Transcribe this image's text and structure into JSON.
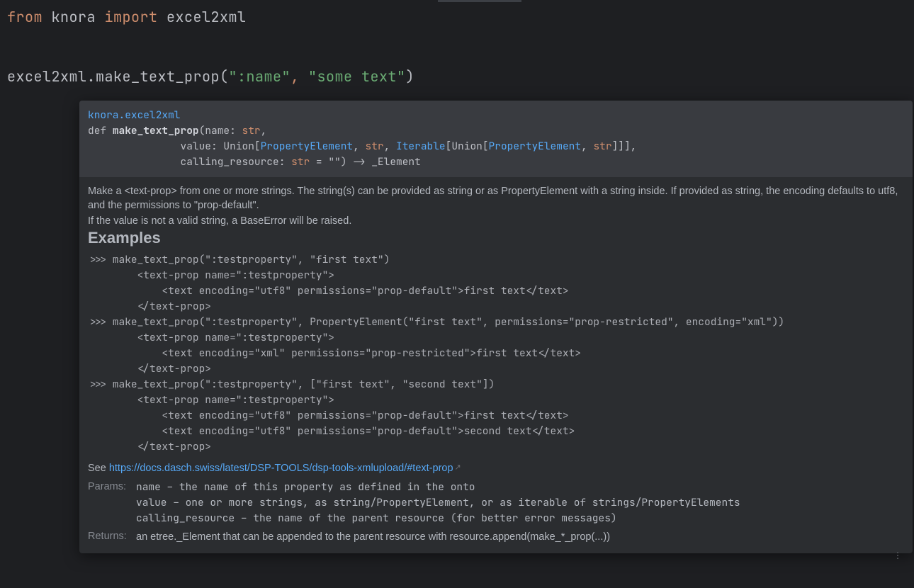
{
  "editor": {
    "line1": {
      "from": "from",
      "mod": "knora",
      "import": "import",
      "name": "excel2xml"
    },
    "line2": {
      "obj": "excel2xml",
      "dot": ".",
      "fn": "make_text_prop",
      "lpar": "(",
      "arg1": "\":name\"",
      "comma": ",",
      "space": " ",
      "arg2": "\"some text\"",
      "rpar": ")"
    }
  },
  "tooltip": {
    "qualified_name": "knora.excel2xml",
    "signature": {
      "def": "def ",
      "name": "make_text_prop",
      "open": "(name: ",
      "p1type": "str",
      "c1": ",",
      "indent2": "               value: Union[",
      "pe1": "PropertyElement",
      "c2": ", ",
      "str2": "str",
      "c3": ", ",
      "iter": "Iterable",
      "br1": "[Union[",
      "pe2": "PropertyElement",
      "c4": ", ",
      "str3": "str",
      "br2": "]]],",
      "indent3": "               calling_resource: ",
      "str4": "str",
      "tail": " = \"\") -> _Element"
    },
    "description1": "Make a <text-prop> from one or more strings. The string(s) can be provided as string or as PropertyElement with a string inside. If provided as string, the encoding defaults to utf8, and the permissions to \"prop-default\".",
    "description2": "If the value is not a valid string, a BaseError will be raised.",
    "examples_heading": "Examples",
    "examples": ">>> make_text_prop(\":testproperty\", \"first text\")\n        <text-prop name=\":testproperty\">\n            <text encoding=\"utf8\" permissions=\"prop-default\">first text</text>\n        </text-prop>\n>>> make_text_prop(\":testproperty\", PropertyElement(\"first text\", permissions=\"prop-restricted\", encoding=\"xml\"))\n        <text-prop name=\":testproperty\">\n            <text encoding=\"xml\" permissions=\"prop-restricted\">first text</text>\n        </text-prop>\n>>> make_text_prop(\":testproperty\", [\"first text\", \"second text\"])\n        <text-prop name=\":testproperty\">\n            <text encoding=\"utf8\" permissions=\"prop-default\">first text</text>\n            <text encoding=\"utf8\" permissions=\"prop-default\">second text</text>\n        </text-prop>",
    "see_prefix": "See ",
    "see_link": "https://docs.dasch.swiss/latest/DSP-TOOLS/dsp-tools-xmlupload/#text-prop",
    "params_label": "Params:",
    "params": {
      "p1": "name – the name of this property as defined in the onto",
      "p2": "value – one or more strings, as string/PropertyElement, or as iterable of strings/PropertyElements",
      "p3": "calling_resource – the name of the parent resource (for better error messages)"
    },
    "returns_label": "Returns:",
    "returns_value": "an etree._Element that can be appended to the parent resource with resource.append(make_*_prop(...))"
  }
}
